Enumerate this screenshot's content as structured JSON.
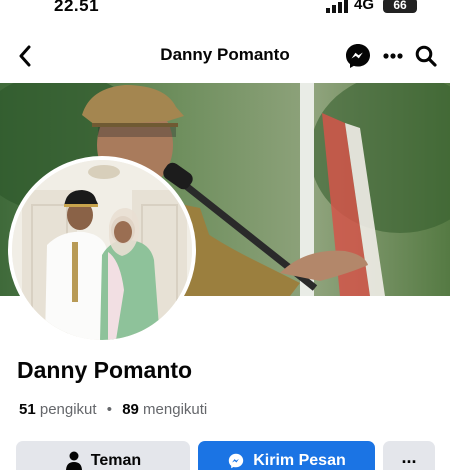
{
  "status_bar": {
    "time": "22.51",
    "network": "4G",
    "battery": "66"
  },
  "nav": {
    "title": "Danny Pomanto"
  },
  "profile": {
    "name": "Danny Pomanto",
    "followers_count": "51",
    "followers_label": "pengikut",
    "separator": "•",
    "following_count": "89",
    "following_label": "mengikuti"
  },
  "actions": {
    "friend_label": "Teman",
    "message_label": "Kirim Pesan",
    "more_label": "..."
  },
  "colors": {
    "primary_blue": "#1b74e4",
    "secondary_button": "#e4e6eb",
    "muted_text": "#65676b"
  },
  "icons": {
    "back": "chevron-left-icon",
    "messenger": "messenger-icon",
    "more": "more-horizontal-icon",
    "search": "search-icon",
    "friend": "person-icon",
    "message": "messenger-icon"
  }
}
